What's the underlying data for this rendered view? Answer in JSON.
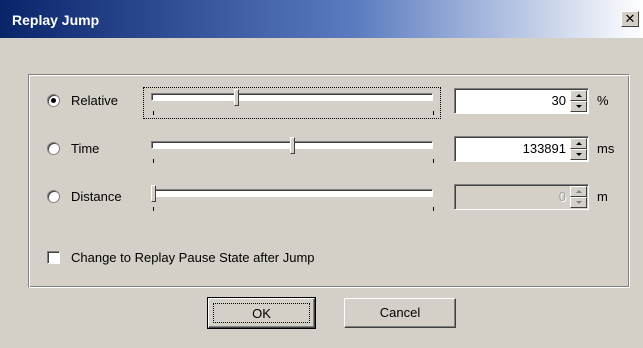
{
  "window": {
    "title": "Replay Jump",
    "close_glyph": "✕"
  },
  "modes": [
    {
      "label": "Relative",
      "selected": true,
      "value": "30",
      "unit": "%",
      "enabled": true,
      "slider_fraction": 0.3
    },
    {
      "label": "Time",
      "selected": false,
      "value": "133891",
      "unit": "ms",
      "enabled": true,
      "slider_fraction": 0.5
    },
    {
      "label": "Distance",
      "selected": false,
      "value": "0",
      "unit": "m",
      "enabled": false,
      "slider_fraction": 0.0
    }
  ],
  "pause_option": {
    "label": "Change to Replay Pause State after Jump",
    "checked": false
  },
  "buttons": {
    "ok": "OK",
    "cancel": "Cancel"
  },
  "icons": {
    "close": "close-icon",
    "spin_up": "spin-up-arrow-icon",
    "spin_down": "spin-down-arrow-icon"
  },
  "colors": {
    "title_start": "#0a246a",
    "dialog_bg": "#d4d0c8"
  }
}
